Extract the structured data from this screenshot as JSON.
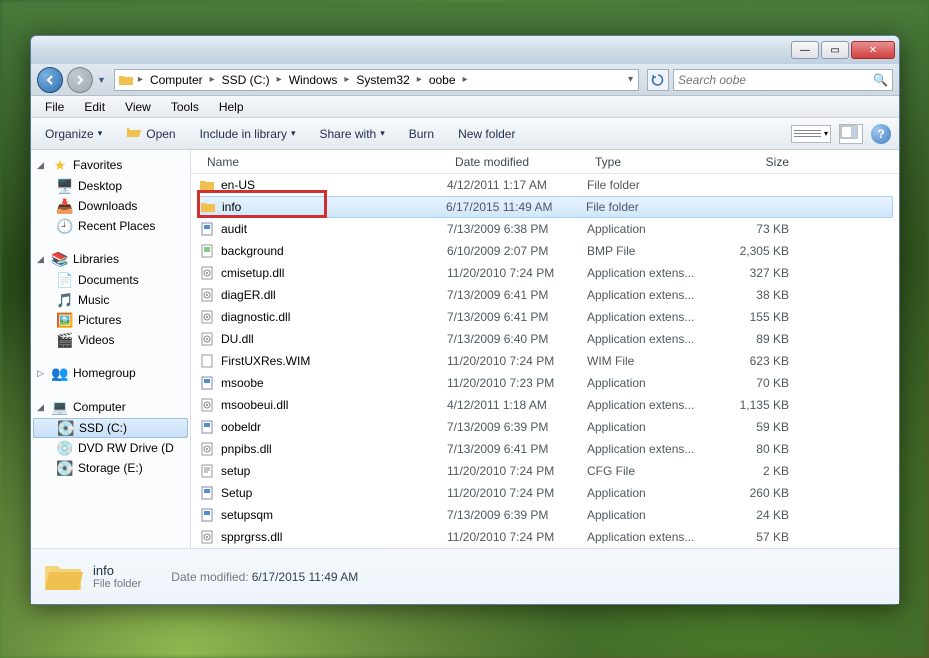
{
  "window_controls": {
    "min": "—",
    "max": "▭",
    "close": "✕"
  },
  "breadcrumb": [
    "Computer",
    "SSD (C:)",
    "Windows",
    "System32",
    "oobe"
  ],
  "search_placeholder": "Search oobe",
  "menubar": [
    "File",
    "Edit",
    "View",
    "Tools",
    "Help"
  ],
  "toolbar": {
    "organize": "Organize",
    "open": "Open",
    "include": "Include in library",
    "share": "Share with",
    "burn": "Burn",
    "newfolder": "New folder"
  },
  "nav": {
    "favorites": {
      "label": "Favorites",
      "items": [
        "Desktop",
        "Downloads",
        "Recent Places"
      ]
    },
    "libraries": {
      "label": "Libraries",
      "items": [
        "Documents",
        "Music",
        "Pictures",
        "Videos"
      ]
    },
    "homegroup": {
      "label": "Homegroup"
    },
    "computer": {
      "label": "Computer",
      "items": [
        "SSD (C:)",
        "DVD RW Drive (D",
        "Storage (E:)"
      ]
    }
  },
  "columns": {
    "name": "Name",
    "date": "Date modified",
    "type": "Type",
    "size": "Size"
  },
  "files": [
    {
      "icon": "folder",
      "name": "en-US",
      "date": "4/12/2011 1:17 AM",
      "type": "File folder",
      "size": ""
    },
    {
      "icon": "folder",
      "name": "info",
      "date": "6/17/2015 11:49 AM",
      "type": "File folder",
      "size": "",
      "selected": true
    },
    {
      "icon": "app",
      "name": "audit",
      "date": "7/13/2009 6:38 PM",
      "type": "Application",
      "size": "73 KB"
    },
    {
      "icon": "bmp",
      "name": "background",
      "date": "6/10/2009 2:07 PM",
      "type": "BMP File",
      "size": "2,305 KB"
    },
    {
      "icon": "dll",
      "name": "cmisetup.dll",
      "date": "11/20/2010 7:24 PM",
      "type": "Application extens...",
      "size": "327 KB"
    },
    {
      "icon": "dll",
      "name": "diagER.dll",
      "date": "7/13/2009 6:41 PM",
      "type": "Application extens...",
      "size": "38 KB"
    },
    {
      "icon": "dll",
      "name": "diagnostic.dll",
      "date": "7/13/2009 6:41 PM",
      "type": "Application extens...",
      "size": "155 KB"
    },
    {
      "icon": "dll",
      "name": "DU.dll",
      "date": "7/13/2009 6:40 PM",
      "type": "Application extens...",
      "size": "89 KB"
    },
    {
      "icon": "wim",
      "name": "FirstUXRes.WIM",
      "date": "11/20/2010 7:24 PM",
      "type": "WIM File",
      "size": "623 KB"
    },
    {
      "icon": "app",
      "name": "msoobe",
      "date": "11/20/2010 7:23 PM",
      "type": "Application",
      "size": "70 KB"
    },
    {
      "icon": "dll",
      "name": "msoobeui.dll",
      "date": "4/12/2011 1:18 AM",
      "type": "Application extens...",
      "size": "1,135 KB"
    },
    {
      "icon": "app",
      "name": "oobeldr",
      "date": "7/13/2009 6:39 PM",
      "type": "Application",
      "size": "59 KB"
    },
    {
      "icon": "dll",
      "name": "pnpibs.dll",
      "date": "7/13/2009 6:41 PM",
      "type": "Application extens...",
      "size": "80 KB"
    },
    {
      "icon": "cfg",
      "name": "setup",
      "date": "11/20/2010 7:24 PM",
      "type": "CFG File",
      "size": "2 KB"
    },
    {
      "icon": "app",
      "name": "Setup",
      "date": "11/20/2010 7:24 PM",
      "type": "Application",
      "size": "260 KB"
    },
    {
      "icon": "app",
      "name": "setupsqm",
      "date": "7/13/2009 6:39 PM",
      "type": "Application",
      "size": "24 KB"
    },
    {
      "icon": "dll",
      "name": "spprgrss.dll",
      "date": "11/20/2010 7:24 PM",
      "type": "Application extens...",
      "size": "57 KB"
    }
  ],
  "details": {
    "name": "info",
    "type": "File folder",
    "meta_label": "Date modified:",
    "meta_value": "6/17/2015 11:49 AM"
  }
}
